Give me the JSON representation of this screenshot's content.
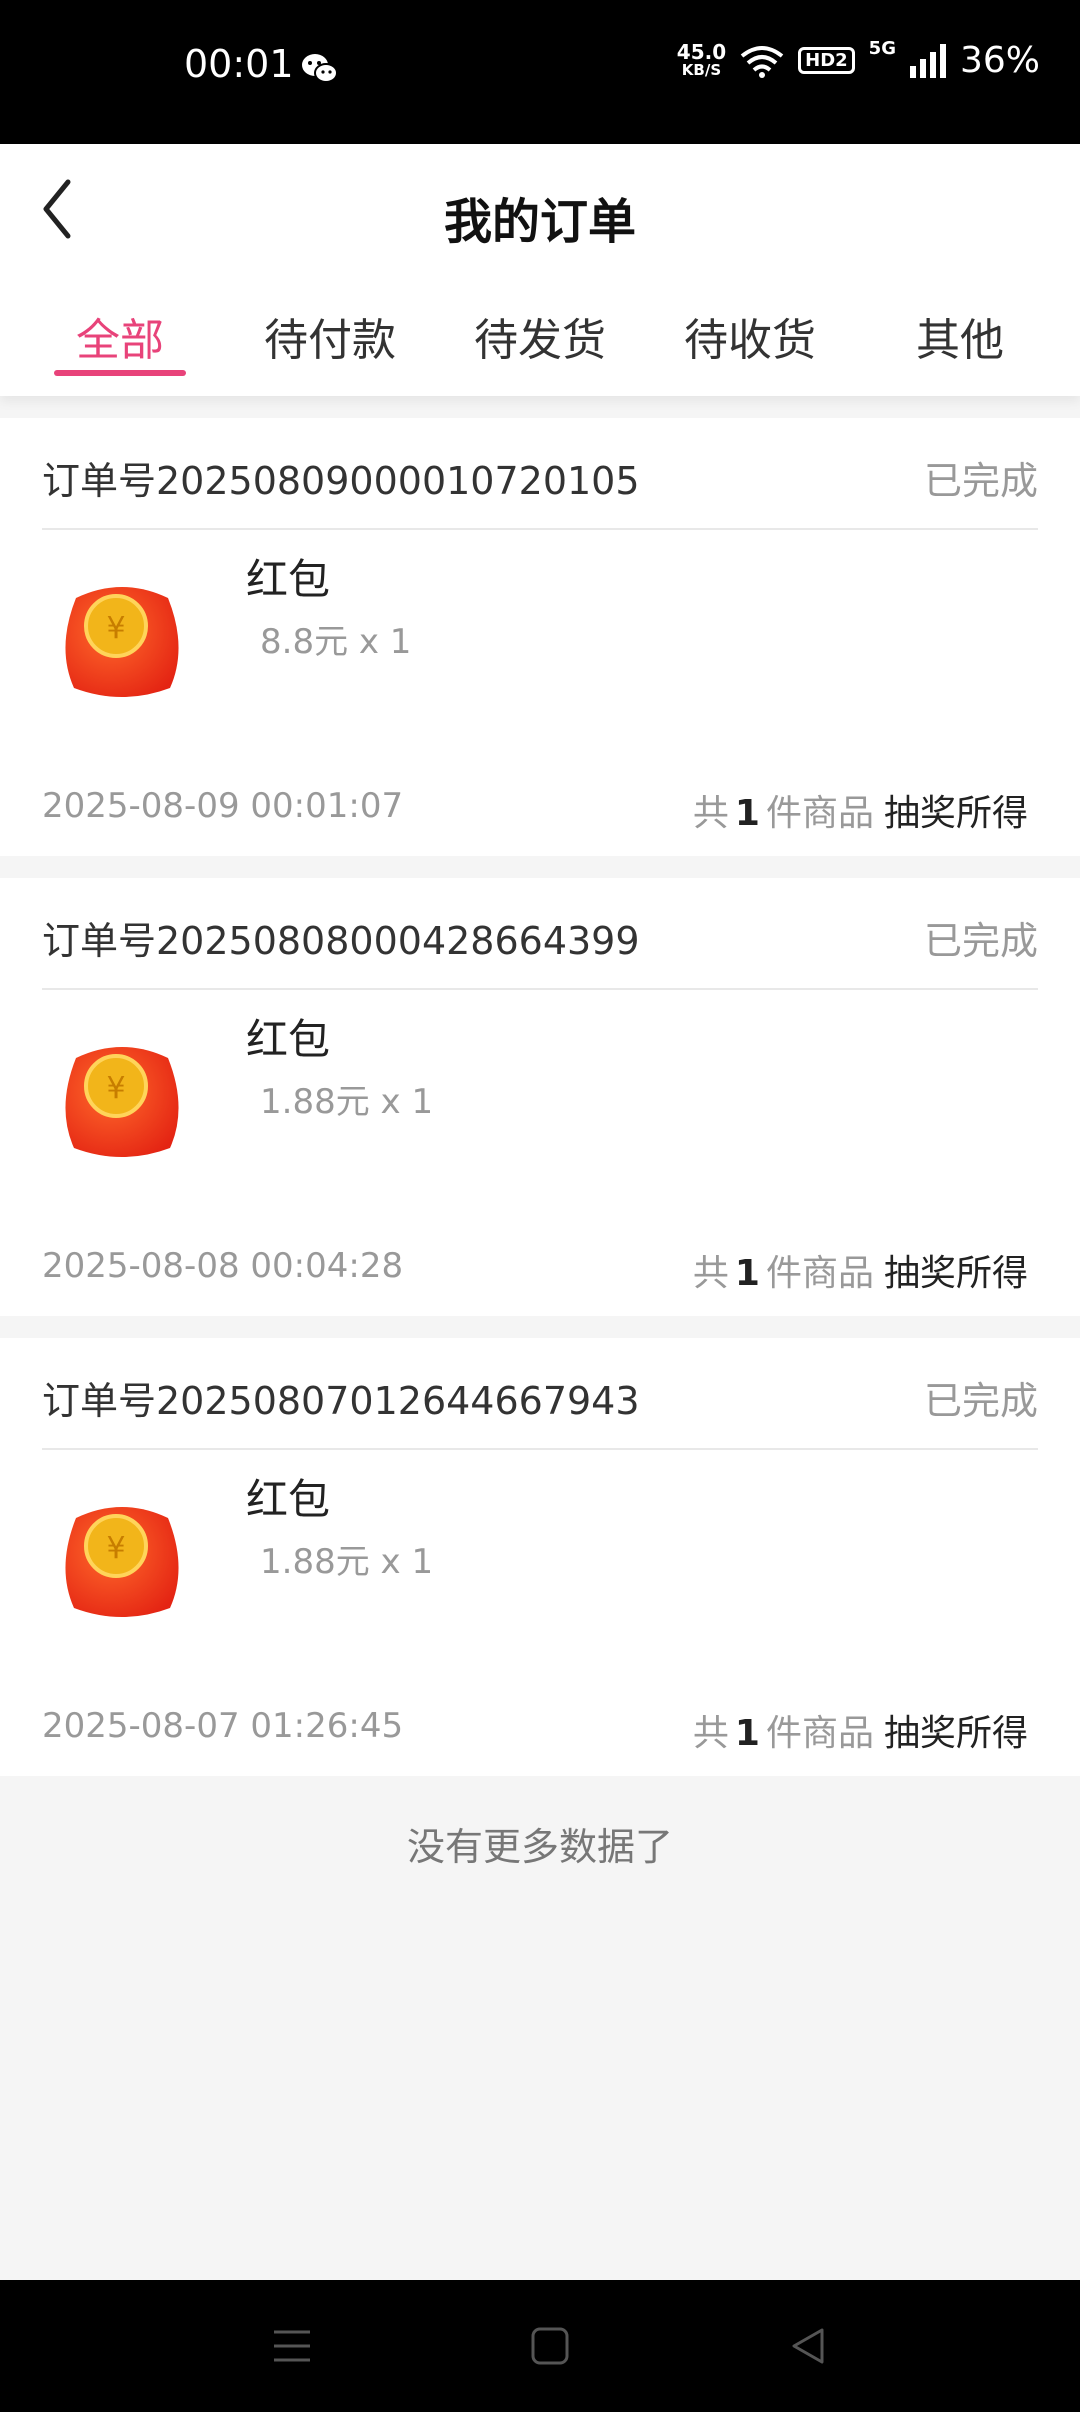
{
  "status_bar": {
    "time": "00:01",
    "net_speed_value": "45.0",
    "net_speed_unit": "KB/S",
    "hd_label": "HD2",
    "network_type": "5G",
    "battery": "36%",
    "icons": [
      "wechat-icon",
      "wifi-icon",
      "signal-icon"
    ]
  },
  "header": {
    "title": "我的订单",
    "back_icon": "chevron-left-icon"
  },
  "tabs": [
    {
      "label": "全部",
      "active": true
    },
    {
      "label": "待付款",
      "active": false
    },
    {
      "label": "待发货",
      "active": false
    },
    {
      "label": "待收货",
      "active": false
    },
    {
      "label": "其他",
      "active": false
    }
  ],
  "orders": [
    {
      "order_no": "订单号20250809000010720105",
      "status": "已完成",
      "product_name": "红包",
      "price_qty": "8.8元 x 1",
      "date": "2025-08-09 00:01:07",
      "count_prefix": "共",
      "count": "1",
      "count_suffix": "件商品",
      "source": "抽奖所得",
      "image": "red-envelope-icon"
    },
    {
      "order_no": "订单号20250808000428664399",
      "status": "已完成",
      "product_name": "红包",
      "price_qty": "1.88元 x 1",
      "date": "2025-08-08 00:04:28",
      "count_prefix": "共",
      "count": "1",
      "count_suffix": "件商品",
      "source": "抽奖所得",
      "image": "red-envelope-icon"
    },
    {
      "order_no": "订单号20250807012644667943",
      "status": "已完成",
      "product_name": "红包",
      "price_qty": "1.88元 x 1",
      "date": "2025-08-07 01:26:45",
      "count_prefix": "共",
      "count": "1",
      "count_suffix": "件商品",
      "source": "抽奖所得",
      "image": "red-envelope-icon"
    }
  ],
  "footer_text": "没有更多数据了",
  "colors": {
    "accent": "#e8437a",
    "muted": "#999999",
    "page_bg": "#f5f5f5"
  }
}
